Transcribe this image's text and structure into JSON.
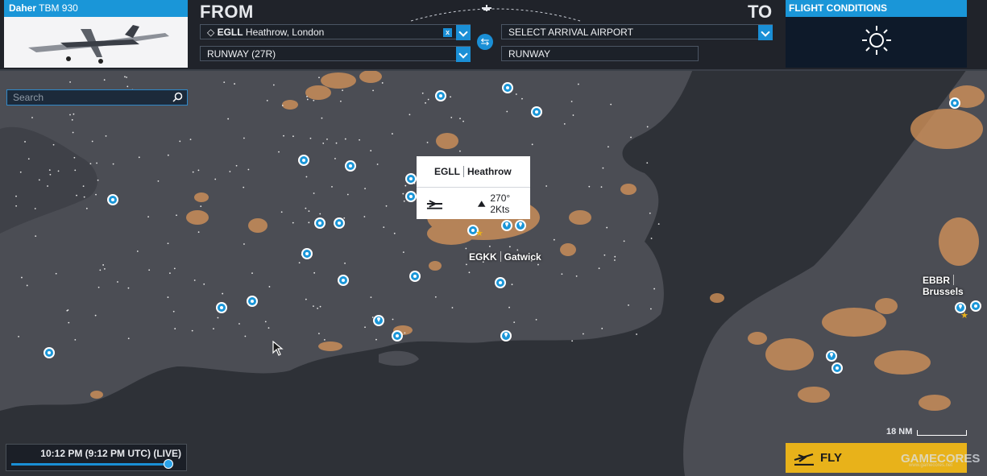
{
  "aircraft": {
    "brand": "Daher",
    "model": "TBM 930"
  },
  "from_label": "FROM",
  "to_label": "TO",
  "departure": {
    "icao": "EGLL",
    "name": "Heathrow, London",
    "clear": "x",
    "runway": "RUNWAY (27R)"
  },
  "arrival": {
    "placeholder": "SELECT ARRIVAL AIRPORT",
    "runway": "RUNWAY"
  },
  "flight_conditions": {
    "title": "FLIGHT CONDITIONS",
    "icon": "sun-icon"
  },
  "search": {
    "placeholder": "Search"
  },
  "selected_airport": {
    "icao": "EGLL",
    "name": "Heathrow",
    "wind": "270° 2Kts"
  },
  "map_labels": [
    {
      "icao": "EGKK",
      "name": "Gatwick"
    },
    {
      "icao": "EBBR",
      "name": "Brussels"
    }
  ],
  "time": {
    "label": "10:12 PM (9:12 PM UTC) (LIVE)",
    "progress": 0.97
  },
  "scale": {
    "label": "18 NM"
  },
  "fly": {
    "label": "FLY"
  },
  "watermark": {
    "text": "GAMECORES",
    "sub": "www.gamecores.net"
  },
  "colors": {
    "accent": "#1a96d8",
    "fly": "#e8b21a",
    "land": "#4a4c53",
    "sea": "#2d3036",
    "city_lights": "#d9955a"
  }
}
